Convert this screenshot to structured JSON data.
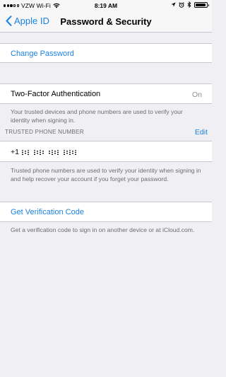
{
  "status_bar": {
    "carrier": "VZW Wi-Fi",
    "time": "8:19 AM",
    "battery_level": 0.9
  },
  "nav": {
    "back_label": "Apple ID",
    "title": "Password & Security"
  },
  "change_password": {
    "label": "Change Password"
  },
  "two_factor": {
    "label": "Two-Factor Authentication",
    "value": "On",
    "footer": "Your trusted devices and phone numbers are used to verify your identity when signing in."
  },
  "trusted_phone": {
    "header": "TRUSTED PHONE NUMBER",
    "edit_label": "Edit",
    "number_prefix": "+1",
    "footer": "Trusted phone numbers are used to verify your identity when signing in and help recover your account if you forget your password."
  },
  "verification": {
    "label": "Get Verification Code",
    "footer": "Get a verification code to sign in on another device or at iCloud.com."
  },
  "colors": {
    "accent": "#1a82e2",
    "background": "#efeff4",
    "secondary_text": "#6d6d72"
  }
}
